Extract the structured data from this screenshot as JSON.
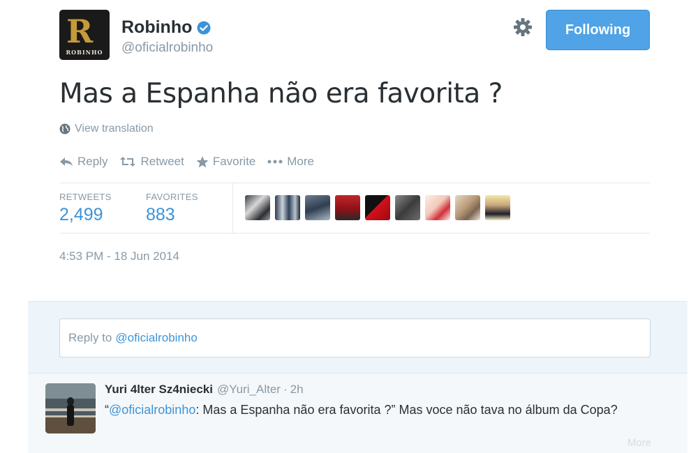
{
  "profile": {
    "name": "Robinho",
    "handle": "@oficialrobinho",
    "avatar_initial": "R",
    "avatar_word": "ROBINHO",
    "follow_label": "Following"
  },
  "tweet": {
    "text": "Mas a Espanha não era favorita ?",
    "translate_label": "View translation",
    "timestamp": "4:53 PM - 18 Jun 2014"
  },
  "actions": [
    {
      "label": "Reply",
      "icon": "reply-icon"
    },
    {
      "label": "Retweet",
      "icon": "retweet-icon"
    },
    {
      "label": "Favorite",
      "icon": "star-icon"
    },
    {
      "label": "More",
      "icon": "dots-icon"
    }
  ],
  "stats": {
    "retweets_label": "RETWEETS",
    "retweets_value": "2,499",
    "favorites_label": "FAVORITES",
    "favorites_value": "883"
  },
  "reply_box": {
    "prefix": "Reply to",
    "mention": "@oficialrobinho"
  },
  "reply_tweet": {
    "name": "Yuri 4lter Sz4niecki",
    "handle": "@Yuri_Alter",
    "separator": "·",
    "time": "2h",
    "quote_open": "“",
    "mention": "@oficialrobinho",
    "text": ": Mas a Espanha não era favorita ?” Mas voce não tava no álbum da Copa?",
    "more_label": "More"
  },
  "colors": {
    "link": "#3b94d9",
    "muted": "#8899a6",
    "button": "#4fa3e6",
    "verified": "#3b94d9"
  }
}
